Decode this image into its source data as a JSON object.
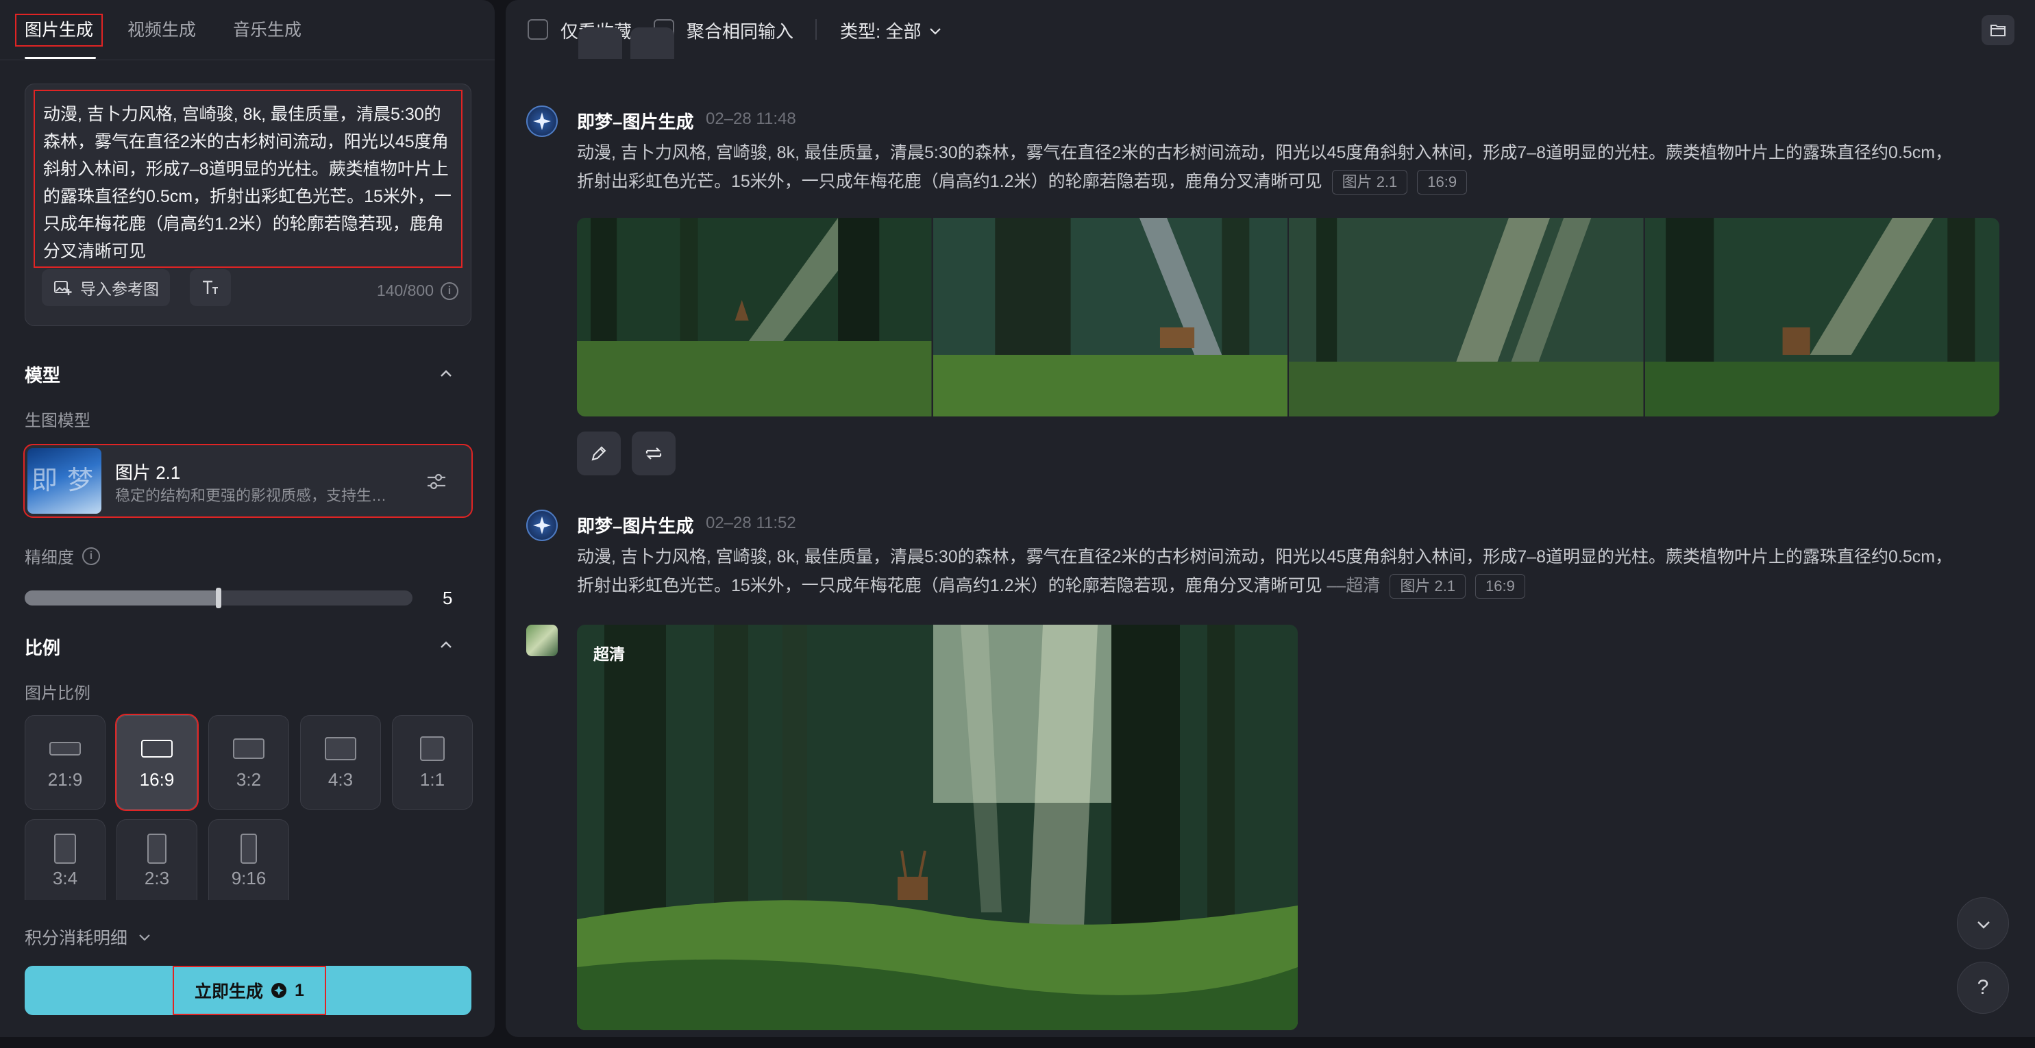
{
  "tabs": [
    {
      "label": "图片生成",
      "active": true
    },
    {
      "label": "视频生成",
      "active": false
    },
    {
      "label": "音乐生成",
      "active": false
    }
  ],
  "prompt": {
    "text": "动漫, 吉卜力风格, 宫崎骏, 8k, 最佳质量，清晨5:30的森林，雾气在直径2米的古杉树间流动，阳光以45度角斜射入林间，形成7–8道明显的光柱。蕨类植物叶片上的露珠直径约0.5cm，折射出彩虹色光芒。15米外，一只成年梅花鹿（肩高约1.2米）的轮廓若隐若现，鹿角分叉清晰可见",
    "import_ref_label": "导入参考图",
    "counter": "140/800"
  },
  "model_section": {
    "title": "模型",
    "sub_label": "生图模型",
    "model_name": "图片 2.1",
    "model_desc": "稳定的结构和更强的影视质感，支持生成中、英文文字",
    "thumb_chars": [
      "即",
      "梦"
    ]
  },
  "precision": {
    "label": "精细度",
    "value": "5",
    "fill_fraction": 0.5
  },
  "ratio_section": {
    "title": "比例",
    "sub_label": "图片比例",
    "options": [
      {
        "label": "21:9",
        "selected": false
      },
      {
        "label": "16:9",
        "selected": true
      },
      {
        "label": "3:2",
        "selected": false
      },
      {
        "label": "4:3",
        "selected": false
      },
      {
        "label": "1:1",
        "selected": false
      },
      {
        "label": "3:4",
        "selected": false
      },
      {
        "label": "2:3",
        "selected": false
      },
      {
        "label": "9:16",
        "selected": false
      }
    ]
  },
  "credits_label": "积分消耗明细",
  "generate": {
    "label": "立即生成",
    "cost": "1"
  },
  "topbar": {
    "fav_only": "仅看收藏",
    "merge_same": "聚合相同输入",
    "type_filter": "类型: 全部"
  },
  "messages": [
    {
      "author": "即梦–图片生成",
      "time": "02–28  11:48",
      "text": "动漫, 吉卜力风格, 宫崎骏, 8k, 最佳质量，清晨5:30的森林，雾气在直径2米的古杉树间流动，阳光以45度角斜射入林间，形成7–8道明显的光柱。蕨类植物叶片上的露珠直径约0.5cm，折射出彩虹色光芒。15米外，一只成年梅花鹿（肩高约1.2米）的轮廓若隐若现，鹿角分叉清晰可见",
      "suffix": "",
      "tags": [
        "图片 2.1",
        "16:9"
      ]
    },
    {
      "author": "即梦–图片生成",
      "time": "02–28  11:52",
      "text": "动漫, 吉卜力风格, 宫崎骏, 8k, 最佳质量，清晨5:30的森林，雾气在直径2米的古杉树间流动，阳光以45度角斜射入林间，形成7–8道明显的光柱。蕨类植物叶片上的露珠直径约0.5cm，折射出彩虹色光芒。15米外，一只成年梅花鹿（肩高约1.2米）的轮廓若隐若现，鹿角分叉清晰可见",
      "suffix": "––超清",
      "tags": [
        "图片 2.1",
        "16:9"
      ],
      "image_badge": "超清"
    }
  ],
  "colors": {
    "accent": "#5ac8dc",
    "highlight_box": "#e02424",
    "panel_bg": "#202229",
    "page_bg": "#131419"
  },
  "icons": {
    "import_ref": "image-plus-icon",
    "text_format": "text-size-icon",
    "info": "info-icon",
    "settings": "sliders-icon",
    "chevron": "chevron-icon",
    "edit": "pencil-icon",
    "regenerate": "refresh-icon",
    "folder": "folder-icon",
    "scroll_down": "chevron-down-icon",
    "help": "question-icon"
  }
}
